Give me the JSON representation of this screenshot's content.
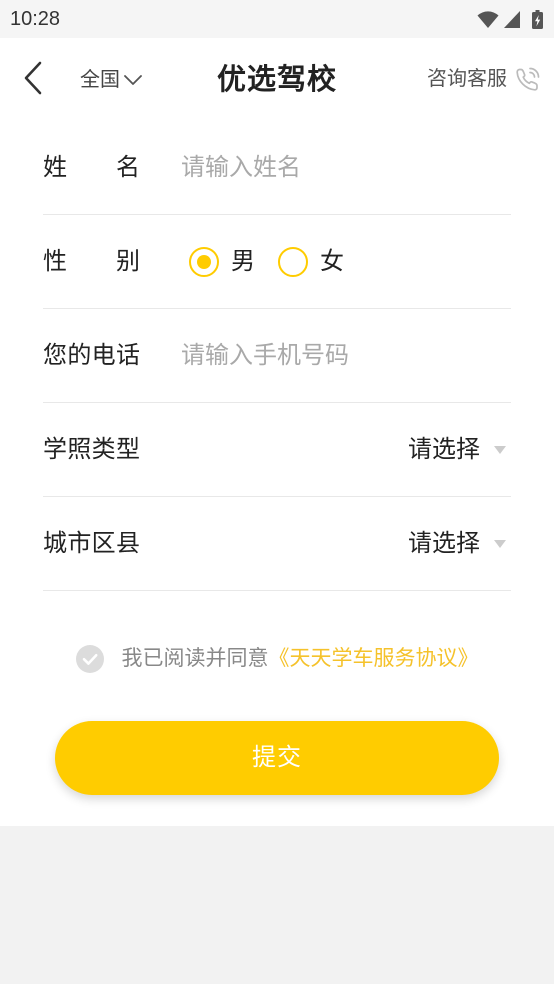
{
  "status_bar": {
    "time": "10:28",
    "icons": [
      "wifi-icon",
      "signal-icon",
      "battery-charging-icon"
    ]
  },
  "header": {
    "back_icon": "back-arrow-icon",
    "city": "全国",
    "city_icon": "chevron-down-icon",
    "title": "优选驾校",
    "service": "咨询客服",
    "service_icon": "phone-icon"
  },
  "form": {
    "name": {
      "label": "姓名",
      "placeholder": "请输入姓名"
    },
    "gender": {
      "label": "性别",
      "options": [
        {
          "label": "男",
          "selected": true
        },
        {
          "label": "女",
          "selected": false
        }
      ]
    },
    "phone": {
      "label": "您的电话",
      "placeholder": "请输入手机号码"
    },
    "license_type": {
      "label": "学照类型",
      "value": "请选择",
      "icon": "dropdown-triangle-icon"
    },
    "city_district": {
      "label": "城市区县",
      "value": "请选择",
      "icon": "dropdown-triangle-icon"
    }
  },
  "agreement": {
    "checked": false,
    "icon": "check-circle-icon",
    "prefix": "我已阅读并同意",
    "link": "《天天学车服务协议》"
  },
  "submit": {
    "label": "提交"
  },
  "colors": {
    "accent": "#FFCC00",
    "link": "#F5C22B",
    "text": "#222222",
    "placeholder": "#A9A9A9",
    "divider": "#E8E8E8",
    "footer_bg": "#F2F2F2"
  }
}
